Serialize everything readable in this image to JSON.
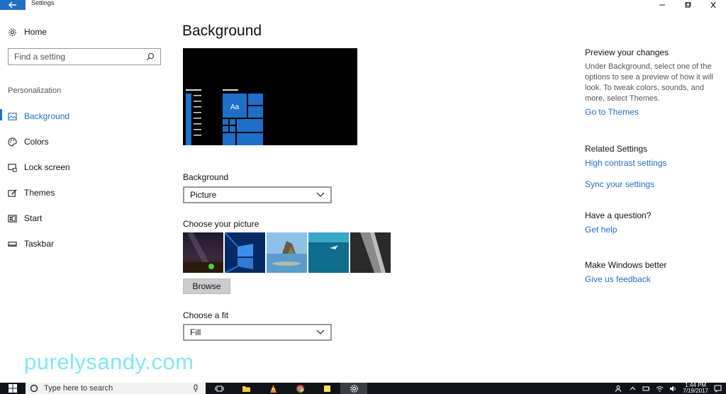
{
  "window": {
    "title": "Settings"
  },
  "sidebar": {
    "home_label": "Home",
    "search_placeholder": "Find a setting",
    "section_label": "Personalization",
    "items": [
      {
        "label": "Background",
        "icon": "picture-icon",
        "active": true
      },
      {
        "label": "Colors",
        "icon": "palette-icon",
        "active": false
      },
      {
        "label": "Lock screen",
        "icon": "lock-screen-icon",
        "active": false
      },
      {
        "label": "Themes",
        "icon": "themes-icon",
        "active": false
      },
      {
        "label": "Start",
        "icon": "start-icon",
        "active": false
      },
      {
        "label": "Taskbar",
        "icon": "taskbar-icon",
        "active": false
      }
    ]
  },
  "main": {
    "title": "Background",
    "preview_tile_text": "Aa",
    "background_label": "Background",
    "background_value": "Picture",
    "choose_picture_label": "Choose your picture",
    "browse_label": "Browse",
    "fit_label": "Choose a fit",
    "fit_value": "Fill"
  },
  "right": {
    "preview_heading": "Preview your changes",
    "preview_text": "Under Background, select one of the options to see a preview of how it will look. To tweak colors, sounds, and more, select Themes.",
    "go_to_themes": "Go to Themes",
    "related_heading": "Related Settings",
    "high_contrast": "High contrast settings",
    "sync": "Sync your settings",
    "question_heading": "Have a question?",
    "get_help": "Get help",
    "better_heading": "Make Windows better",
    "feedback": "Give us feedback"
  },
  "watermark": "purelysandy.com",
  "taskbar": {
    "search_placeholder": "Type here to search",
    "time": "1:44 PM",
    "date": "7/19/2017"
  },
  "colors": {
    "accent": "#1e6fc8",
    "taskbar": "#101418"
  }
}
